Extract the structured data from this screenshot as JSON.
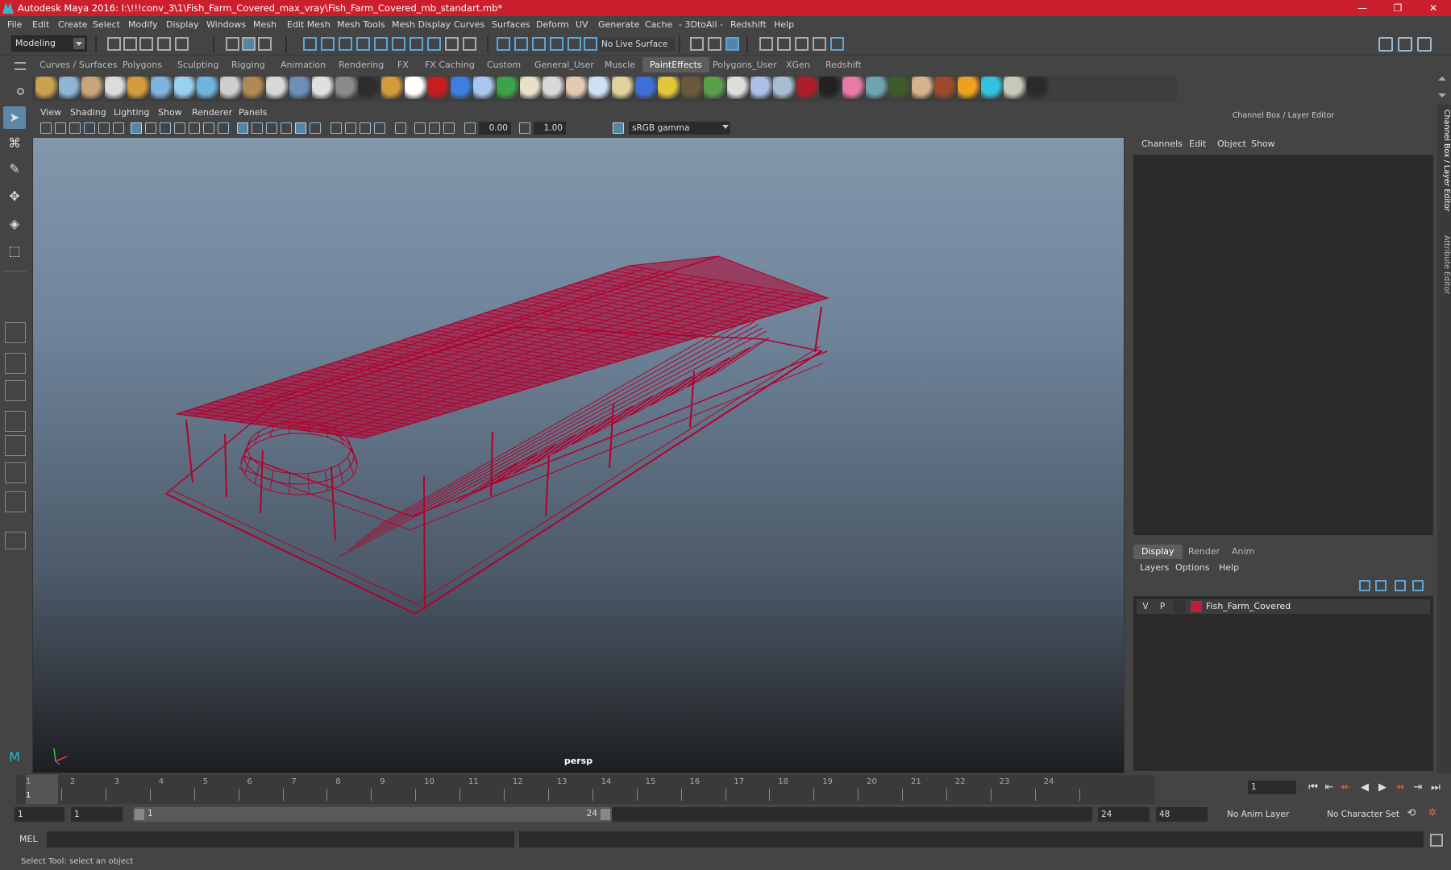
{
  "window": {
    "title": "Autodesk Maya 2016: I:\\!!!conv_3\\1\\Fish_Farm_Covered_max_vray\\Fish_Farm_Covered_mb_standart.mb*",
    "minimize": "—",
    "maximize": "❐",
    "close": "✕"
  },
  "menus": [
    "File",
    "Edit",
    "Create",
    "Select",
    "Modify",
    "Display",
    "Windows",
    "Mesh",
    "Edit Mesh",
    "Mesh Tools",
    "Mesh Display",
    "Curves",
    "Surfaces",
    "Deform",
    "UV",
    "Generate",
    "Cache",
    "- 3DtoAll -",
    "Redshift",
    "Help"
  ],
  "statusline": {
    "mode": "Modeling",
    "live_surface": "No Live Surface"
  },
  "shelf": {
    "tabs": [
      "Curves / Surfaces",
      "Polygons",
      "Sculpting",
      "Rigging",
      "Animation",
      "Rendering",
      "FX",
      "FX Caching",
      "Custom",
      "General_User",
      "Muscle",
      "PaintEffects",
      "Polygons_User",
      "XGen",
      "Redshift"
    ],
    "active_tab": "PaintEffects"
  },
  "viewport": {
    "menus": [
      "View",
      "Shading",
      "Lighting",
      "Show",
      "Renderer",
      "Panels"
    ],
    "exposure": "0.00",
    "gamma": "1.00",
    "color_space": "sRGB gamma",
    "camera": "persp",
    "wireframe_color": "#b3002d"
  },
  "right_panel": {
    "title": "Channel Box / Layer Editor",
    "channel_menus": [
      "Channels",
      "Edit",
      "Object",
      "Show"
    ],
    "layer_tabs": [
      "Display",
      "Render",
      "Anim"
    ],
    "active_layer_tab": "Display",
    "layer_menus": [
      "Layers",
      "Options",
      "Help"
    ],
    "layer": {
      "visible": "V",
      "playback": "P",
      "name": "Fish_Farm_Covered",
      "color": "#bf1f3e"
    },
    "side_tabs": [
      "Channel Box / Layer Editor",
      "Attribute Editor"
    ]
  },
  "timeline": {
    "ticks": [
      "1",
      "2",
      "3",
      "4",
      "5",
      "6",
      "7",
      "8",
      "9",
      "10",
      "11",
      "12",
      "13",
      "14",
      "15",
      "16",
      "17",
      "18",
      "19",
      "20",
      "21",
      "22",
      "23",
      "24"
    ],
    "current_frame": "1",
    "current_frame_field": "1"
  },
  "range": {
    "start": "1",
    "playback_start": "1",
    "range_start_label": "1",
    "range_end_label": "24",
    "playback_end": "24",
    "end": "48",
    "anim_layer": "No Anim Layer",
    "character_set": "No Character Set"
  },
  "cmdline": {
    "language": "MEL"
  },
  "help_line": "Select Tool: select an object"
}
